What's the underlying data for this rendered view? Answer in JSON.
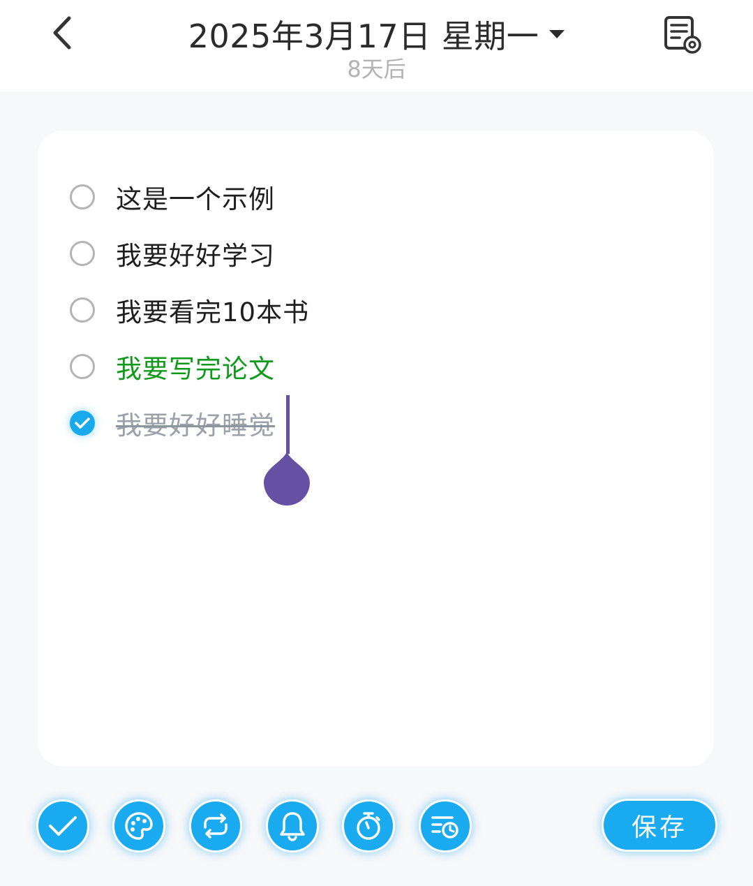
{
  "header": {
    "title": "2025年3月17日 星期一",
    "subtitle": "8天后",
    "icons": {
      "back": "chevron-left-icon",
      "dropdown": "caret-down-icon",
      "settings": "note-settings-icon"
    }
  },
  "todos": [
    {
      "text": "这是一个示例",
      "checked": false,
      "color": "#1e1e1e"
    },
    {
      "text": "我要好好学习",
      "checked": false,
      "color": "#1e1e1e"
    },
    {
      "text": "我要看完10本书",
      "checked": false,
      "color": "#1e1e1e"
    },
    {
      "text": "我要写完论文",
      "checked": false,
      "color": "#0f9a1b"
    },
    {
      "text": "我要好好睡觉",
      "checked": true,
      "color": "#9aa1a8"
    }
  ],
  "toolbar": {
    "buttons": [
      "check-icon",
      "palette-icon",
      "repeat-icon",
      "bell-icon",
      "stopwatch-icon",
      "list-clock-icon"
    ],
    "save_label": "保存"
  },
  "colors": {
    "accent": "#1aaaf0",
    "cursor": "#6650a4"
  }
}
